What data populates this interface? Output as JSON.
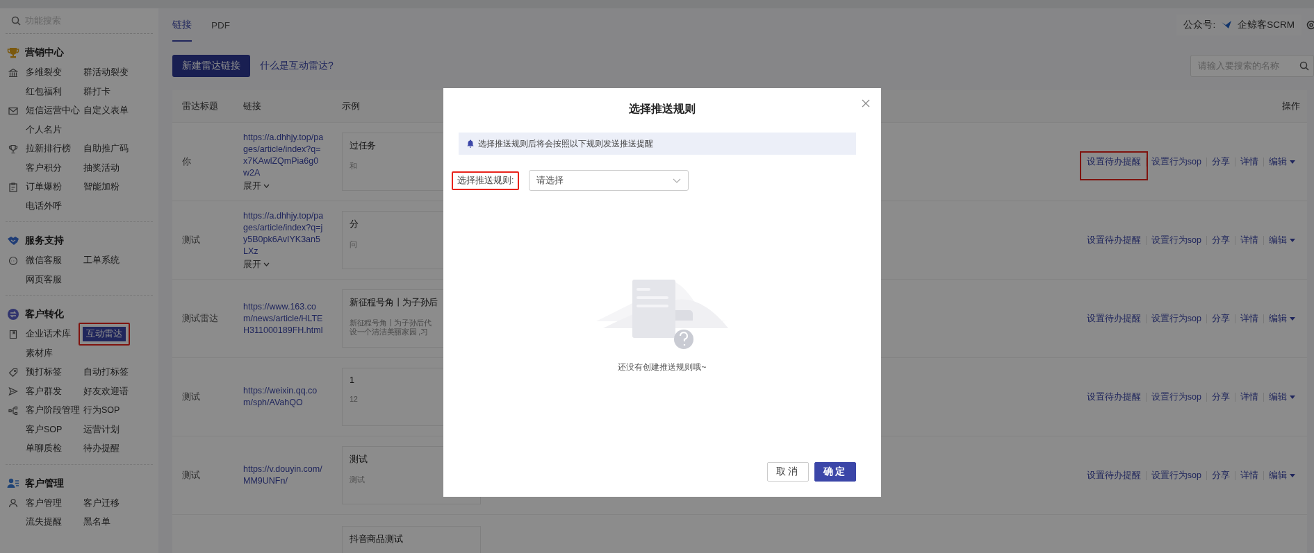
{
  "sidebar": {
    "search_placeholder": "功能搜索",
    "sections": [
      {
        "title": "营销中心",
        "rows": [
          [
            {
              "label": "多维裂变",
              "selected": false,
              "highlighted": false
            },
            {
              "label": "群活动裂变",
              "selected": false,
              "highlighted": false
            }
          ],
          [
            {
              "label": "红包福利",
              "selected": false,
              "highlighted": false
            },
            {
              "label": "群打卡",
              "selected": false,
              "highlighted": false
            }
          ],
          [
            {
              "label": "短信运营中心",
              "selected": false,
              "highlighted": false
            },
            {
              "label": "自定义表单",
              "selected": false,
              "highlighted": false
            }
          ],
          [
            {
              "label": "个人名片",
              "selected": false,
              "highlighted": false
            }
          ],
          [
            {
              "label": "拉新排行榜",
              "selected": false,
              "highlighted": false
            },
            {
              "label": "自助推广码",
              "selected": false,
              "highlighted": false
            }
          ],
          [
            {
              "label": "客户积分",
              "selected": false,
              "highlighted": false
            },
            {
              "label": "抽奖活动",
              "selected": false,
              "highlighted": false
            }
          ],
          [
            {
              "label": "订单爆粉",
              "selected": false,
              "highlighted": false
            },
            {
              "label": "智能加粉",
              "selected": false,
              "highlighted": false
            }
          ],
          [
            {
              "label": "电话外呼",
              "selected": false,
              "highlighted": false
            }
          ]
        ]
      },
      {
        "title": "服务支持",
        "rows": [
          [
            {
              "label": "微信客服",
              "selected": false,
              "highlighted": false
            },
            {
              "label": "工单系统",
              "selected": false,
              "highlighted": false
            }
          ],
          [
            {
              "label": "网页客服",
              "selected": false,
              "highlighted": false
            }
          ]
        ]
      },
      {
        "title": "客户转化",
        "rows": [
          [
            {
              "label": "企业话术库",
              "selected": false,
              "highlighted": false
            },
            {
              "label": "互动雷达",
              "selected": true,
              "highlighted": true
            }
          ],
          [
            {
              "label": "素材库",
              "selected": false,
              "highlighted": false
            }
          ],
          [
            {
              "label": "预打标签",
              "selected": false,
              "highlighted": false
            },
            {
              "label": "自动打标签",
              "selected": false,
              "highlighted": false
            }
          ],
          [
            {
              "label": "客户群发",
              "selected": false,
              "highlighted": false
            },
            {
              "label": "好友欢迎语",
              "selected": false,
              "highlighted": false
            }
          ],
          [
            {
              "label": "客户阶段管理",
              "selected": false,
              "highlighted": false
            },
            {
              "label": "行为SOP",
              "selected": false,
              "highlighted": false
            }
          ],
          [
            {
              "label": "客户SOP",
              "selected": false,
              "highlighted": false
            },
            {
              "label": "运营计划",
              "selected": false,
              "highlighted": false
            }
          ],
          [
            {
              "label": "单聊质检",
              "selected": false,
              "highlighted": false
            },
            {
              "label": "待办提醒",
              "selected": false,
              "highlighted": false
            }
          ]
        ]
      },
      {
        "title": "客户管理",
        "rows": [
          [
            {
              "label": "客户管理",
              "selected": false,
              "highlighted": false
            },
            {
              "label": "客户迁移",
              "selected": false,
              "highlighted": false
            }
          ],
          [
            {
              "label": "流失提醒",
              "selected": false,
              "highlighted": false
            },
            {
              "label": "黑名单",
              "selected": false,
              "highlighted": false
            }
          ]
        ]
      }
    ]
  },
  "tabs": [
    {
      "label": "链接",
      "selected": true
    },
    {
      "label": "PDF",
      "selected": false
    }
  ],
  "account": {
    "label": "公众号:",
    "name": "企鲸客SCRM"
  },
  "toolbar": {
    "new_button": "新建雷达链接",
    "help_link": "什么是互动雷达?",
    "search_placeholder": "请输入要搜索的名称"
  },
  "table": {
    "columns": [
      "雷达标题",
      "链接",
      "示例",
      "操作"
    ],
    "rows": [
      {
        "title": "你",
        "link": "https://a.dhhjy.top/pages/article/index?q=x7KAwlZQmPia6g0w2A",
        "expand": "展开",
        "example": {
          "title": "过任务",
          "desc": [
            "和"
          ]
        },
        "actions": [
          {
            "label": "设置待办提醒",
            "highlighted": true
          },
          {
            "label": "设置行为sop",
            "highlighted": false
          },
          {
            "label": "分享",
            "highlighted": false
          },
          {
            "label": "详情",
            "highlighted": false
          },
          {
            "label": "编辑",
            "highlighted": false
          }
        ]
      },
      {
        "title": "测试",
        "link": "https://a.dhhjy.top/pages/article/index?q=jy5B0pk6AvIYK3an5LXz",
        "expand": "展开",
        "example": {
          "title": "分",
          "desc": [
            "问"
          ]
        },
        "actions": [
          {
            "label": "设置待办提醒",
            "highlighted": false
          },
          {
            "label": "设置行为sop",
            "highlighted": false
          },
          {
            "label": "分享",
            "highlighted": false
          },
          {
            "label": "详情",
            "highlighted": false
          },
          {
            "label": "编辑",
            "highlighted": false
          }
        ]
      },
      {
        "title": "测试雷达",
        "link": "https://www.163.com/news/article/HLTEH311000189FH.html",
        "example": {
          "title": "新征程号角丨为子孙后",
          "desc": [
            "新征程号角丨为子孙后代",
            "设一个清洁美丽家园 ,习"
          ]
        },
        "actions": [
          {
            "label": "设置待办提醒",
            "highlighted": false
          },
          {
            "label": "设置行为sop",
            "highlighted": false
          },
          {
            "label": "分享",
            "highlighted": false
          },
          {
            "label": "详情",
            "highlighted": false
          },
          {
            "label": "编辑",
            "highlighted": false
          }
        ]
      },
      {
        "title": "测试",
        "link": "https://weixin.qq.com/sph/AVahQO",
        "example": {
          "title": "1",
          "desc": [
            "12"
          ]
        },
        "actions": [
          {
            "label": "设置待办提醒",
            "highlighted": false
          },
          {
            "label": "设置行为sop",
            "highlighted": false
          },
          {
            "label": "分享",
            "highlighted": false
          },
          {
            "label": "详情",
            "highlighted": false
          },
          {
            "label": "编辑",
            "highlighted": false
          }
        ]
      },
      {
        "title": "测试",
        "link": "https://v.douyin.com/MM9UNFn/",
        "example": {
          "title": "测试",
          "desc": [
            "测试"
          ]
        },
        "actions": [
          {
            "label": "设置待办提醒",
            "highlighted": false
          },
          {
            "label": "设置行为sop",
            "highlighted": false
          },
          {
            "label": "分享",
            "highlighted": false
          },
          {
            "label": "详情",
            "highlighted": false
          },
          {
            "label": "编辑",
            "highlighted": false
          }
        ]
      },
      {
        "example": {
          "title": "抖音商品测试"
        }
      }
    ]
  },
  "dialog": {
    "title": "选择推送规则",
    "notice": "选择推送规则后将会按照以下规则发送推送提醒",
    "field": {
      "label": "选择推送规则:",
      "highlighted": true,
      "placeholder": "请选择"
    },
    "empty_text": "还没有创建推送规则哦~",
    "buttons": [
      {
        "label": "取消",
        "kind": "default"
      },
      {
        "label": "确定",
        "kind": "primary"
      }
    ]
  }
}
